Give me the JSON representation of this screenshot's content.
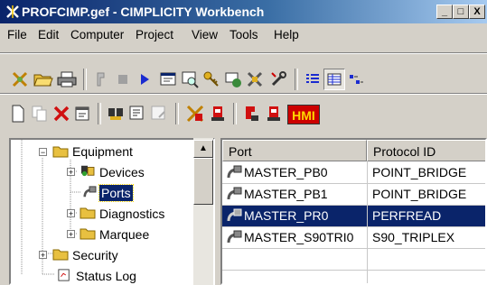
{
  "window": {
    "title": "PROFCIMP.gef - CIMPLICITY Workbench"
  },
  "caption_buttons": [
    "_",
    "□",
    "X"
  ],
  "menu": [
    "File",
    "Edit",
    "Computer",
    "Project",
    "View",
    "Tools",
    "Help"
  ],
  "toolbar2": {
    "hmi_label": "HMI"
  },
  "tree": {
    "nodes": [
      {
        "label": "Equipment",
        "expander": "−"
      },
      {
        "label": "Devices",
        "expander": "+"
      },
      {
        "label": "Ports"
      },
      {
        "label": "Diagnostics",
        "expander": "+"
      },
      {
        "label": "Marquee",
        "expander": "+"
      },
      {
        "label": "Security",
        "expander": "+"
      },
      {
        "label": "Status Log"
      }
    ]
  },
  "grid": {
    "columns": [
      "Port",
      "Protocol ID"
    ],
    "rows": [
      {
        "port": "MASTER_PB0",
        "protocol": "POINT_BRIDGE",
        "selected": false
      },
      {
        "port": "MASTER_PB1",
        "protocol": "POINT_BRIDGE",
        "selected": false
      },
      {
        "port": "MASTER_PR0",
        "protocol": "PERFREAD",
        "selected": true
      },
      {
        "port": "MASTER_S90TRI0",
        "protocol": "S90_TRIPLEX",
        "selected": false
      }
    ]
  },
  "colors": {
    "title_bar": "#0a246a",
    "selection": "#0a246a",
    "face": "#d4d0c8",
    "hmi_bg": "#cc0000",
    "hmi_text": "#ffd800"
  }
}
